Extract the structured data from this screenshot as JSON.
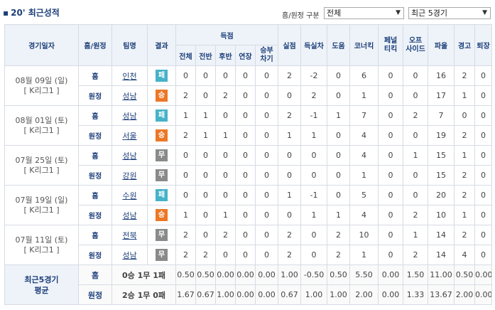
{
  "header": {
    "title": "20' 최근성적",
    "filter_label": "홈/원정 구분",
    "venue_select": "전체",
    "games_select": "최근 5경기"
  },
  "columns": {
    "date": "경기일자",
    "home_away": "홈/원정",
    "team": "팀명",
    "result": "결과",
    "goals": "득점",
    "goals_sub": [
      "전체",
      "전반",
      "후반",
      "연장",
      "승부차기"
    ],
    "conceded": "실점",
    "goal_diff": "득실차",
    "assists": "도움",
    "corners": "코너킥",
    "penalty_kicks": "페널티킥",
    "offsides": "오프사이드",
    "fouls": "파울",
    "warnings": "경고",
    "sendoffs": "퇴장"
  },
  "matches": [
    {
      "date": "08월 09일 (일)",
      "league": "[ K리그1 ]",
      "rows": [
        {
          "ha": "홈",
          "team": "인천",
          "result": "패",
          "type": "lose",
          "stats": [
            "0",
            "0",
            "0",
            "0",
            "0",
            "2",
            "-2",
            "0",
            "6",
            "0",
            "0",
            "16",
            "2",
            "0"
          ]
        },
        {
          "ha": "원정",
          "team": "성남",
          "result": "승",
          "type": "win",
          "stats": [
            "2",
            "0",
            "2",
            "0",
            "0",
            "0",
            "2",
            "0",
            "1",
            "0",
            "0",
            "17",
            "1",
            "0"
          ]
        }
      ]
    },
    {
      "date": "08월 01일 (토)",
      "league": "[ K리그1 ]",
      "rows": [
        {
          "ha": "홈",
          "team": "성남",
          "result": "패",
          "type": "lose",
          "stats": [
            "1",
            "1",
            "0",
            "0",
            "0",
            "2",
            "-1",
            "1",
            "7",
            "0",
            "2",
            "7",
            "0",
            "0"
          ]
        },
        {
          "ha": "원정",
          "team": "서울",
          "result": "승",
          "type": "win",
          "stats": [
            "2",
            "1",
            "1",
            "0",
            "0",
            "1",
            "1",
            "0",
            "4",
            "0",
            "0",
            "19",
            "2",
            "0"
          ]
        }
      ]
    },
    {
      "date": "07월 25일 (토)",
      "league": "[ K리그1 ]",
      "rows": [
        {
          "ha": "홈",
          "team": "성남",
          "result": "무",
          "type": "draw",
          "stats": [
            "0",
            "0",
            "0",
            "0",
            "0",
            "0",
            "0",
            "0",
            "4",
            "0",
            "1",
            "15",
            "1",
            "0"
          ]
        },
        {
          "ha": "원정",
          "team": "강원",
          "result": "무",
          "type": "draw",
          "stats": [
            "0",
            "0",
            "0",
            "0",
            "0",
            "0",
            "0",
            "0",
            "1",
            "0",
            "0",
            "15",
            "2",
            "0"
          ]
        }
      ]
    },
    {
      "date": "07월 19일 (일)",
      "league": "[ K리그1 ]",
      "rows": [
        {
          "ha": "홈",
          "team": "수원",
          "result": "패",
          "type": "lose",
          "stats": [
            "0",
            "0",
            "0",
            "0",
            "0",
            "1",
            "-1",
            "0",
            "5",
            "0",
            "0",
            "20",
            "2",
            "0"
          ]
        },
        {
          "ha": "원정",
          "team": "성남",
          "result": "승",
          "type": "win",
          "stats": [
            "1",
            "0",
            "1",
            "0",
            "0",
            "0",
            "1",
            "1",
            "4",
            "0",
            "2",
            "10",
            "1",
            "0"
          ]
        }
      ]
    },
    {
      "date": "07월 11일 (토)",
      "league": "[ K리그1 ]",
      "rows": [
        {
          "ha": "홈",
          "team": "전북",
          "result": "무",
          "type": "draw",
          "stats": [
            "2",
            "0",
            "2",
            "0",
            "0",
            "2",
            "0",
            "2",
            "10",
            "0",
            "1",
            "14",
            "2",
            "0"
          ]
        },
        {
          "ha": "원정",
          "team": "성남",
          "result": "무",
          "type": "draw",
          "stats": [
            "2",
            "2",
            "0",
            "0",
            "0",
            "2",
            "0",
            "2",
            "1",
            "0",
            "2",
            "14",
            "4",
            "0"
          ]
        }
      ]
    }
  ],
  "averages": {
    "title_line1": "최근5경기",
    "title_line2": "평균",
    "rows": [
      {
        "ha": "홈",
        "record": "0승 1무 1패",
        "stats": [
          "0.50",
          "0.50",
          "0.00",
          "0.00",
          "0.00",
          "1.00",
          "-0.50",
          "0.50",
          "5.50",
          "0.00",
          "1.50",
          "11.00",
          "0.50",
          "0.00"
        ]
      },
      {
        "ha": "원정",
        "record": "2승 1무 0패",
        "stats": [
          "1.67",
          "0.67",
          "1.00",
          "0.00",
          "0.00",
          "0.67",
          "1.00",
          "1.00",
          "2.00",
          "0.00",
          "1.33",
          "13.67",
          "2.00",
          "0.00"
        ]
      }
    ]
  },
  "colors": {
    "lose": "#45b2c8",
    "win": "#ec7726",
    "draw": "#8a8a8a",
    "header_text": "#1d3f7a"
  }
}
